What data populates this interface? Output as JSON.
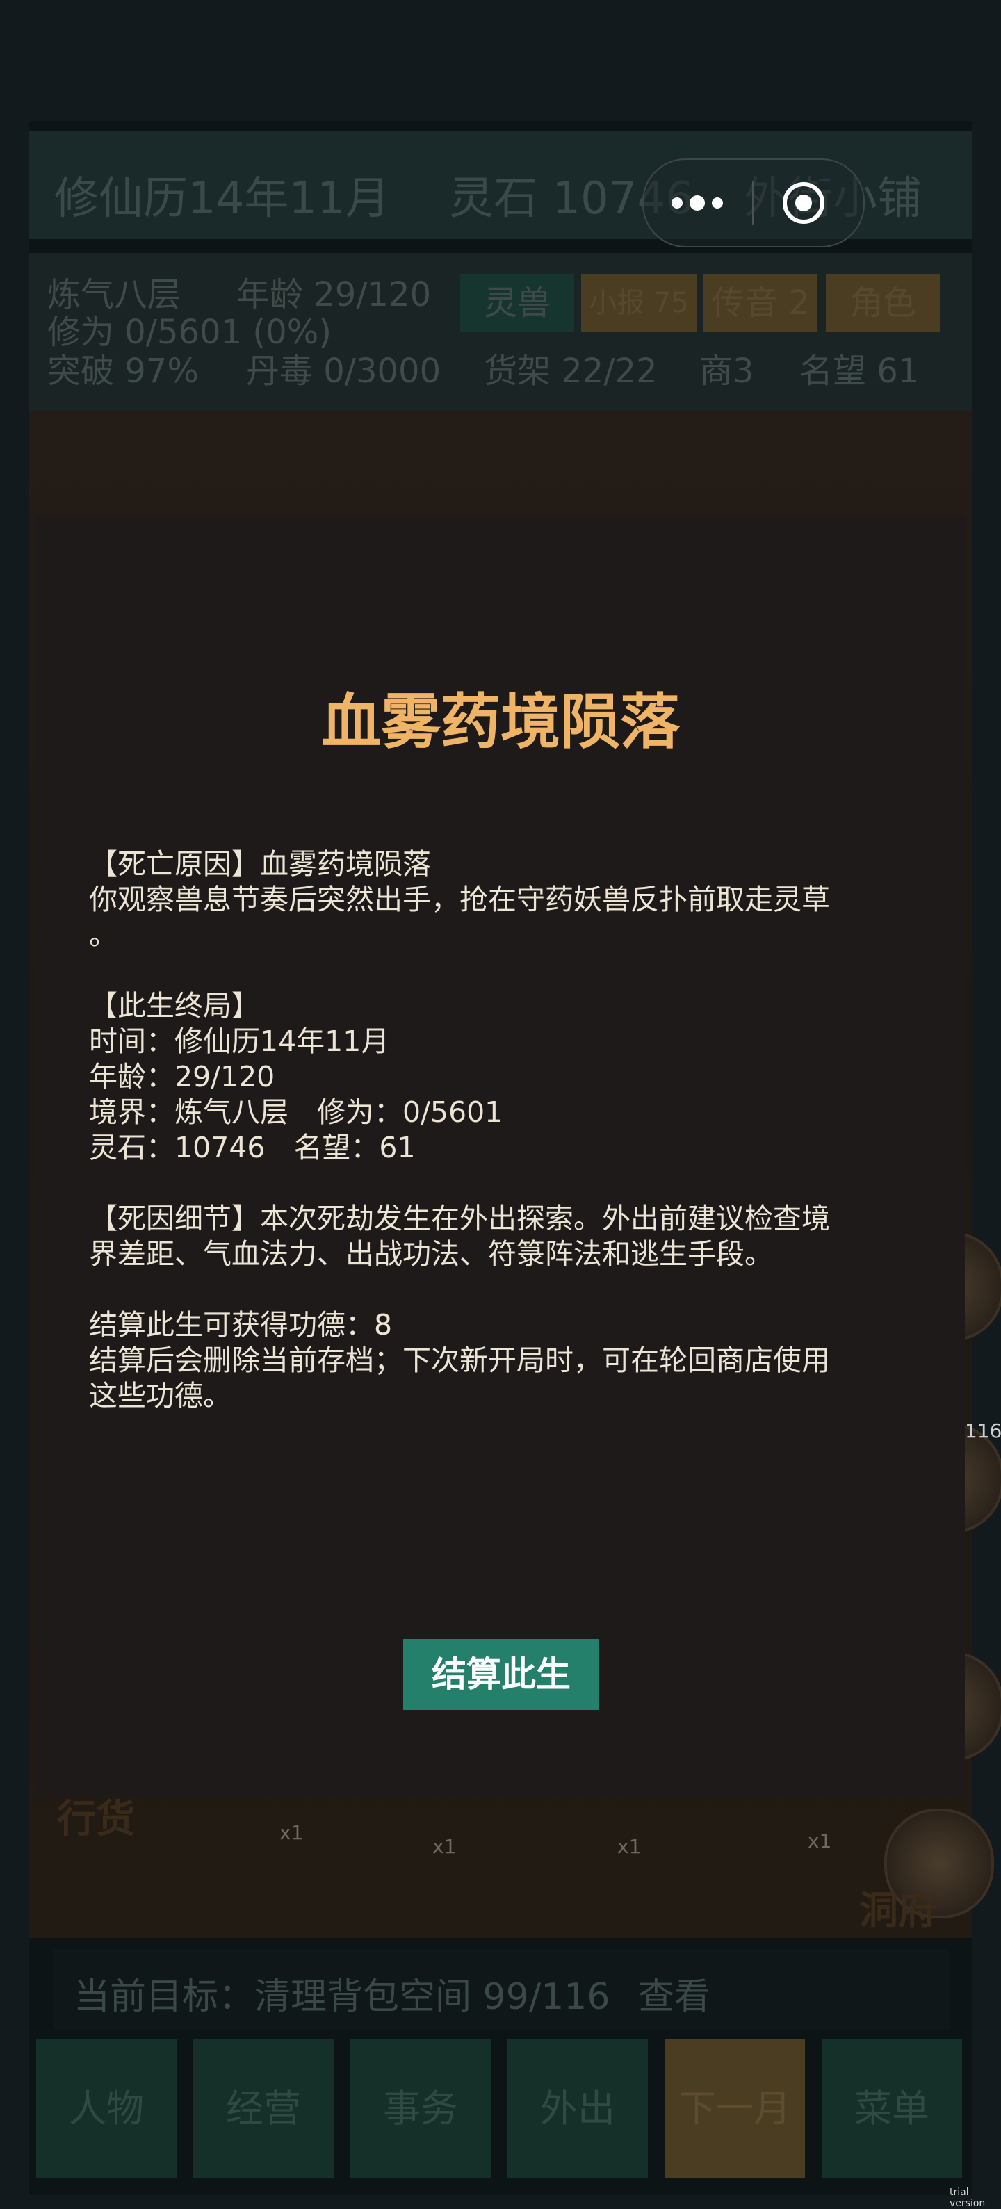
{
  "header": {
    "date": "修仙历14年11月",
    "spirit_stones": "灵石 10746",
    "location_partial": "外街小铺"
  },
  "status": {
    "realm": "炼气八层",
    "age": "年龄 29/120",
    "cultivation": "修为 0/5601 (0%)",
    "breakthrough": "突破 97%",
    "pill_poison": "丹毒 0/3000",
    "shelf": "货架 22/22",
    "merchants": "商3",
    "reputation": "名望 61",
    "chips": [
      "灵兽",
      "小报 75",
      "传音 2",
      "角色"
    ]
  },
  "scene": {
    "xlabels": [
      "x1",
      "x1",
      "x1",
      "x1"
    ],
    "word_left": "行货",
    "word_right": "洞府",
    "side_number": "116"
  },
  "goal": {
    "text": "当前目标：清理背包空间 99/116",
    "link": "查看"
  },
  "nav": [
    "人物",
    "经营",
    "事务",
    "外出",
    "下一月",
    "菜单"
  ],
  "modal": {
    "title": "血雾药境陨落",
    "lines": [
      "【死亡原因】血雾药境陨落",
      "你观察兽息节奏后突然出手，抢在守药妖兽反扑前取走灵草",
      "。",
      "",
      "【此生终局】",
      "时间：修仙历14年11月",
      "年龄：29/120",
      "境界：炼气八层　修为：0/5601",
      "灵石：10746　名望：61",
      "",
      "【死因细节】本次死劫发生在外出探索。外出前建议检查境",
      "界差距、气血法力、出战功法、符箓阵法和逃生手段。",
      "",
      "结算此生可获得功德：8",
      "结算后会删除当前存档；下次新开局时，可在轮回商店使用",
      "这些功德。"
    ],
    "confirm_label": "结算此生"
  },
  "watermark": "trial version"
}
